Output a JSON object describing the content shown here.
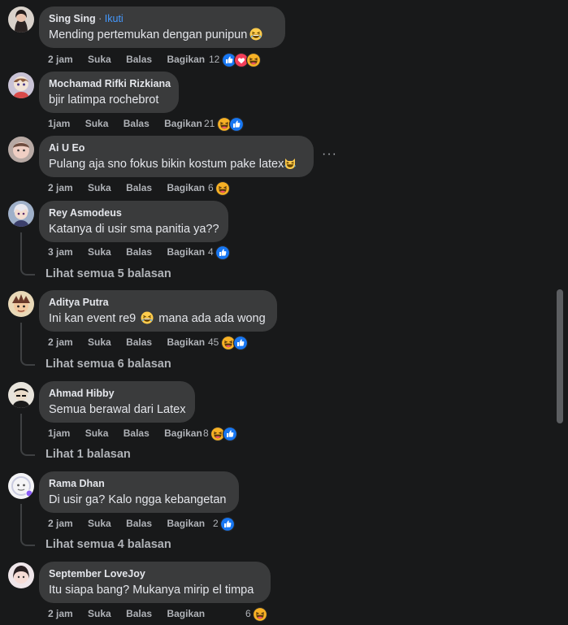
{
  "actions": {
    "like": "Suka",
    "reply": "Balas",
    "share": "Bagikan"
  },
  "comments": [
    {
      "name": "Sing Sing",
      "follow": "Ikuti",
      "separator": "·",
      "text": "Mending pertemukan dengan punipun",
      "time": "2 jam",
      "react_count": "12",
      "reactions": [
        "like",
        "love",
        "haha"
      ],
      "inline_emoji": "grinning-squint"
    },
    {
      "name": "Mochamad Rifki Rizkiana",
      "text": "bjir latimpa rochebrot",
      "time": "1jam",
      "react_count": "21",
      "reactions": [
        "haha",
        "like"
      ]
    },
    {
      "name": "Ai U Eo",
      "text": "Pulang aja sno fokus bikin kostum pake latex",
      "time": "2 jam",
      "react_count": "6",
      "reactions": [
        "haha"
      ],
      "inline_emoji": "laughing-cat",
      "more_label": "···"
    },
    {
      "name": "Rey Asmodeus",
      "text": "Katanya di usir sma panitia ya??",
      "time": "3 jam",
      "react_count": "4",
      "reactions": [
        "like"
      ],
      "replies_label": "Lihat semua 5 balasan"
    },
    {
      "name": "Aditya Putra",
      "text_before": "Ini kan event re9",
      "text_after": "mana ada ada wong",
      "time": "2 jam",
      "react_count": "45",
      "reactions": [
        "haha",
        "like"
      ],
      "inline_emoji": "grinning-squint",
      "replies_label": "Lihat semua 6 balasan"
    },
    {
      "name": "Ahmad Hibby",
      "text": "Semua berawal dari Latex",
      "time": "1jam",
      "react_count": "8",
      "reactions": [
        "haha",
        "like"
      ],
      "replies_label": "Lihat 1 balasan"
    },
    {
      "name": "Rama Dhan",
      "text": "Di usir ga? Kalo ngga kebangetan",
      "time": "2 jam",
      "react_count": "2",
      "reactions": [
        "like"
      ],
      "replies_label": "Lihat semua 4 balasan"
    },
    {
      "name": "September LoveJoy",
      "text": "Itu siapa bang? Mukanya mirip el timpa",
      "time": "2 jam",
      "react_count": "6",
      "reactions": [
        "haha"
      ]
    }
  ],
  "colors": {
    "background": "#18191a",
    "bubble": "#3a3b3c",
    "link": "#4599ff",
    "like": "#1877f2",
    "love": "#f33e58",
    "haha": "#f7b125"
  }
}
